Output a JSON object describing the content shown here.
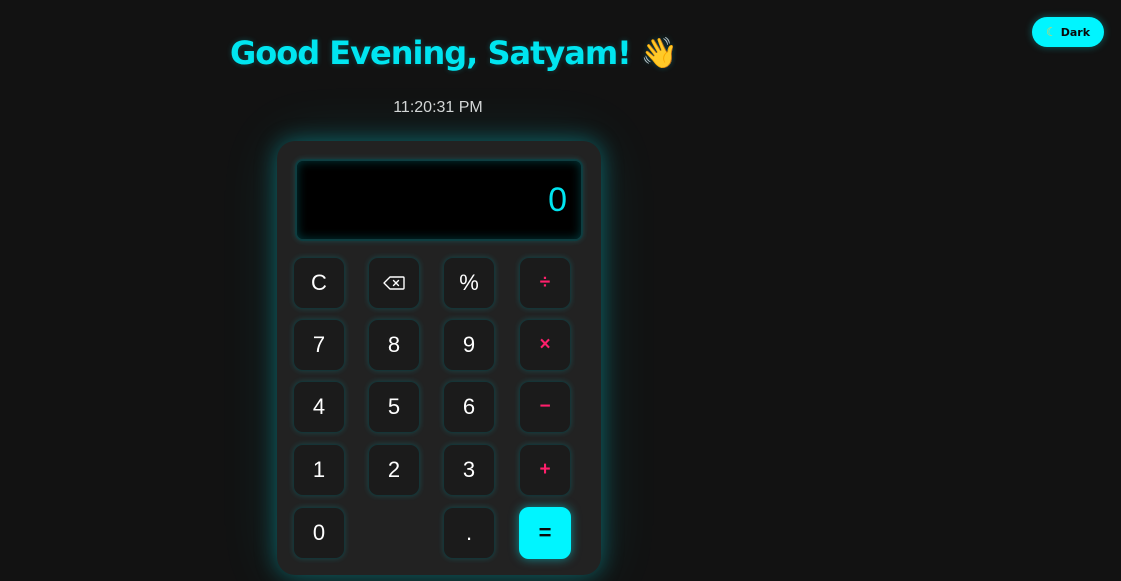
{
  "theme_toggle": {
    "icon": "moon-icon",
    "label": "Dark"
  },
  "greeting": {
    "text": "Good Evening, Satyam!",
    "emoji": "👋"
  },
  "clock": {
    "time": "11:20:31 PM"
  },
  "display": {
    "value": "0"
  },
  "keys": {
    "clear": "C",
    "backspace_icon": "backspace-icon",
    "percent": "%",
    "divide": "÷",
    "seven": "7",
    "eight": "8",
    "nine": "9",
    "multiply": "×",
    "four": "4",
    "five": "5",
    "six": "6",
    "subtract": "−",
    "one": "1",
    "two": "2",
    "three": "3",
    "add": "+",
    "zero": "0",
    "decimal": ".",
    "equals": "="
  },
  "colors": {
    "accent": "#00f5ff",
    "operator": "#ff1f6b",
    "background": "#121212",
    "panel": "#222222"
  }
}
